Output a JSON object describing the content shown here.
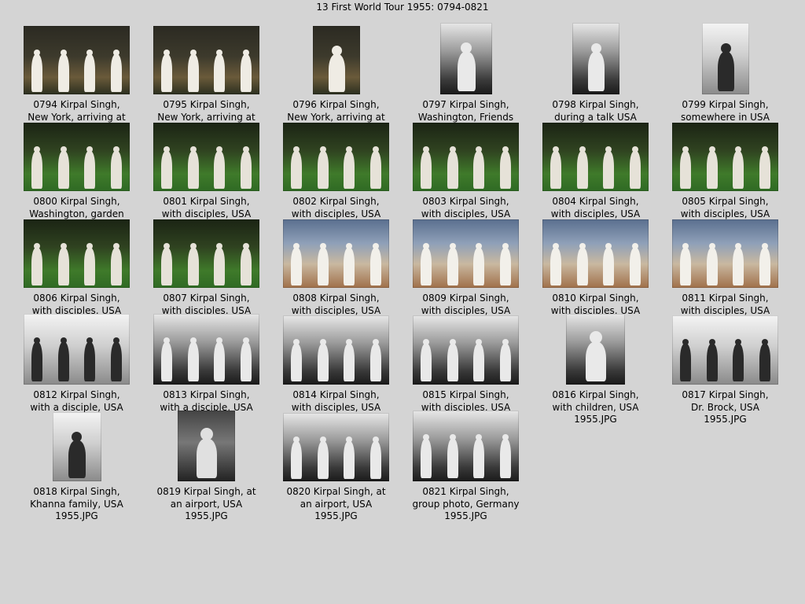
{
  "page_title": "13 First World Tour 1955: 0794-0821",
  "thumbnails": [
    {
      "caption_lines": [
        "0794  Kirpal Singh,",
        "New York, arriving at"
      ],
      "style": "color"
    },
    {
      "caption_lines": [
        "0795  Kirpal Singh,",
        "New York, arriving at"
      ],
      "style": "color"
    },
    {
      "caption_lines": [
        "0796  Kirpal Singh,",
        "New York, arriving at"
      ],
      "style": "color"
    },
    {
      "caption_lines": [
        "0797  Kirpal Singh,",
        "Washington, Friends"
      ],
      "style": "bw"
    },
    {
      "caption_lines": [
        "0798  Kirpal Singh,",
        "during a talk USA"
      ],
      "style": "bw"
    },
    {
      "caption_lines": [
        "0799  Kirpal Singh,",
        "somewhere in USA"
      ],
      "style": "bwlight"
    },
    {
      "caption_lines": [
        "0800  Kirpal Singh,",
        "Washington, garden"
      ],
      "style": "garden"
    },
    {
      "caption_lines": [
        "0801  Kirpal Singh,",
        "with disciples, USA"
      ],
      "style": "garden"
    },
    {
      "caption_lines": [
        "0802  Kirpal Singh,",
        "with disciples, USA"
      ],
      "style": "garden"
    },
    {
      "caption_lines": [
        "0803  Kirpal Singh,",
        "with disciples, USA"
      ],
      "style": "garden"
    },
    {
      "caption_lines": [
        "0804  Kirpal Singh,",
        "with disciples, USA"
      ],
      "style": "garden"
    },
    {
      "caption_lines": [
        "0805  Kirpal Singh,",
        "with disciples, USA"
      ],
      "style": "garden"
    },
    {
      "caption_lines": [
        "0806  Kirpal Singh,",
        "with disciples, USA"
      ],
      "style": "garden"
    },
    {
      "caption_lines": [
        "0807  Kirpal Singh,",
        "with disciples, USA"
      ],
      "style": "garden"
    },
    {
      "caption_lines": [
        "0808  Kirpal Singh,",
        "with disciples, USA"
      ],
      "style": "room"
    },
    {
      "caption_lines": [
        "0809  Kirpal Singh,",
        "with disciples, USA"
      ],
      "style": "room"
    },
    {
      "caption_lines": [
        "0810  Kirpal Singh,",
        "with disciples, USA"
      ],
      "style": "room"
    },
    {
      "caption_lines": [
        "0811  Kirpal Singh,",
        "with disciples, USA"
      ],
      "style": "room"
    },
    {
      "caption_lines": [
        "0812  Kirpal Singh,",
        "with a disciple, USA"
      ],
      "style": "bwlight"
    },
    {
      "caption_lines": [
        "0813  Kirpal Singh,",
        "with a disciple, USA"
      ],
      "style": "bw"
    },
    {
      "caption_lines": [
        "0814  Kirpal Singh,",
        "with disciples, USA"
      ],
      "style": "bw"
    },
    {
      "caption_lines": [
        "0815  Kirpal Singh,",
        "with disciples, USA"
      ],
      "style": "bw"
    },
    {
      "caption_lines": [
        "0816  Kirpal Singh,",
        "with children, USA",
        "1955.JPG"
      ],
      "style": "bw"
    },
    {
      "caption_lines": [
        "0817  Kirpal Singh,",
        "Dr. Brock, USA",
        "1955.JPG"
      ],
      "style": "bwlight"
    },
    {
      "caption_lines": [
        "0818  Kirpal Singh,",
        "Khanna family, USA",
        "1955.JPG"
      ],
      "style": "bwlight"
    },
    {
      "caption_lines": [
        "0819  Kirpal Singh, at",
        "an airport, USA",
        "1955.JPG"
      ],
      "style": "bwdark"
    },
    {
      "caption_lines": [
        "0820  Kirpal Singh, at",
        "an airport, USA",
        "1955.JPG"
      ],
      "style": "bw"
    },
    {
      "caption_lines": [
        "0821  Kirpal Singh,",
        "group photo, Germany",
        "1955.JPG"
      ],
      "style": "bw"
    }
  ]
}
